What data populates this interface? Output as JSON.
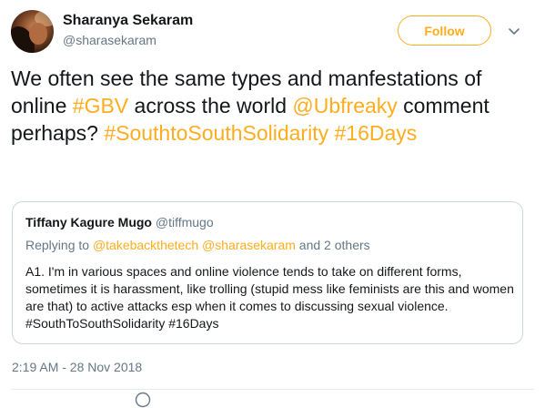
{
  "author": {
    "name": "Sharanya Sekaram",
    "handle": "@sharasekaram"
  },
  "follow_label": "Follow",
  "tweet": {
    "t1": "We often see the same types and manfestations of online ",
    "h_gbv": "#GBV",
    "t2": " across the world ",
    "m_ubfreaky": "@Ubfreaky",
    "t3": " comment perhaps? ",
    "h_s2s": "#SouthtoSouthSolidarity",
    "t4": " ",
    "h_16days": "#16Days"
  },
  "quoted": {
    "name": "Tiffany Kagure Mugo",
    "handle": "@tiffmugo",
    "replying_prefix": "Replying to ",
    "replying_to_1": "@takebackthetech",
    "replying_to_2": "@sharasekaram",
    "replying_suffix": " and 2 others",
    "body": "A1. I'm in various spaces and online violence tends to take on different forms, sometimes it is harassment, like trolling (stupid mess like feminists are this and women are that) to active attacks esp when it comes to discussing sexual violence. #SouthToSouthSolidarity #16Days"
  },
  "timestamp": "2:19 AM - 28 Nov 2018",
  "colors": {
    "accent": "#ffad1f",
    "text": "#14171a",
    "muted": "#657786",
    "border": "#ccd6dd"
  },
  "icons": {
    "caret": "chevron-down-icon",
    "bottom": "reply-icon"
  }
}
